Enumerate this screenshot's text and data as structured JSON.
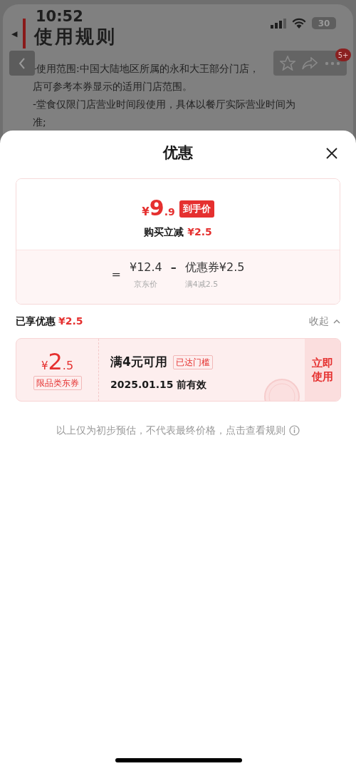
{
  "status_bar": {
    "time": "10:52",
    "battery": "30"
  },
  "background_page": {
    "back_app": "◀",
    "title": "使用规则",
    "badge": "5+",
    "rule_lines": [
      "-使用范围:中国大陆地区所属的永和大王部分门店，",
      "店可参考本券显示的适用门店范围。",
      "-堂食仅限门店营业时间段使用，具体以餐厅实际营业时间为",
      "准;"
    ]
  },
  "sheet": {
    "title": "优惠",
    "price_card": {
      "currency": "¥",
      "integer": "9",
      "decimal": ".9",
      "tag": "到手价",
      "summary_label": "购买立减",
      "summary_amount": "¥2.5",
      "equals": "=",
      "base_price": "¥12.4",
      "base_label": "京东价",
      "minus": "–",
      "coupon_price": "优惠券¥2.5",
      "coupon_label": "满4减2.5"
    },
    "enjoyed": {
      "label": "已享优惠",
      "amount": "¥2.5",
      "toggle": "收起",
      "expanded": true
    },
    "coupon": {
      "currency": "¥",
      "integer": "2",
      "decimal": ".5",
      "type": "限品类东券",
      "title": "满4元可用",
      "threshold_tag": "已达门槛",
      "validity": "2025.01.15 前有效",
      "action": "立即使用"
    },
    "footer_note": "以上仅为初步预估，不代表最终价格，点击查看规则"
  }
}
